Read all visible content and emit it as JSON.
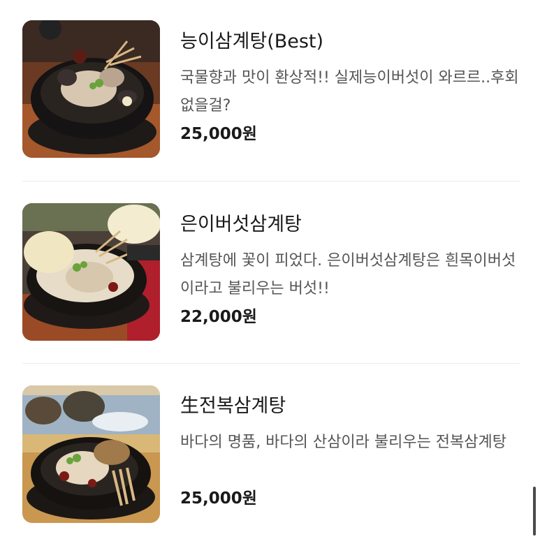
{
  "menu": {
    "items": [
      {
        "name": "능이삼계탕(Best)",
        "description": "국물향과 맛이 환상적!! 실제능이버섯이 와르르..후회없을걸?",
        "price": "25,000원",
        "image_icon": "ginseng-chicken-soup-black-mushroom-photo"
      },
      {
        "name": "은이버섯삼계탕",
        "description": "삼계탕에 꽃이 피었다. 은이버섯삼계탕은 흰목이버섯이라고 불리우는 버섯!!",
        "price": "22,000원",
        "image_icon": "ginseng-chicken-soup-white-fungus-photo"
      },
      {
        "name": "生전복삼계탕",
        "description": "바다의 명품, 바다의 산삼이라 불리우는 전복삼계탕",
        "price": "25,000원",
        "image_icon": "ginseng-chicken-soup-abalone-photo"
      }
    ]
  },
  "colors": {
    "text_primary": "#1a1a1a",
    "text_secondary": "#555555",
    "divider": "#ececec",
    "scrollbar": "#4b4b4b"
  }
}
